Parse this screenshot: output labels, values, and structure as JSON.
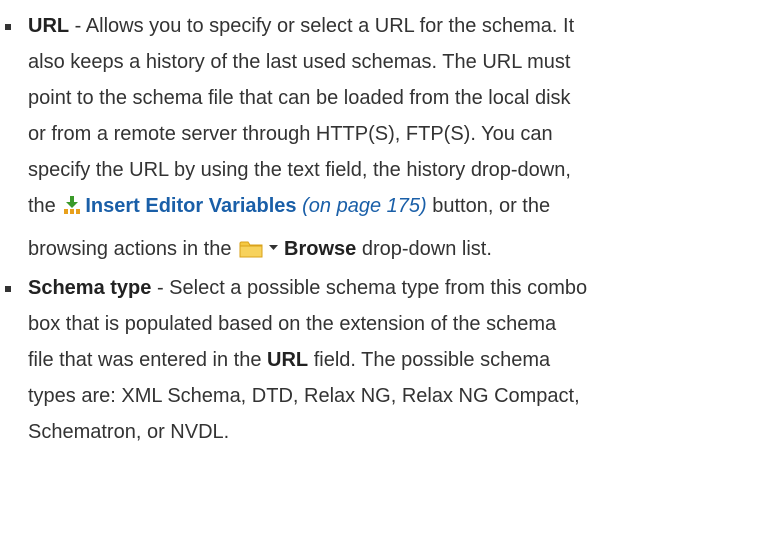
{
  "items": [
    {
      "term": "URL",
      "lines": {
        "l1": " - Allows you to specify or select a URL for the schema. It",
        "l2": "also keeps a history of the last used schemas. The URL must",
        "l3": "point to the schema file that can be loaded from the local disk",
        "l4": "or from a remote server through HTTP(S), FTP(S). You can",
        "l5": "specify the URL by using the text field, the history drop-down,",
        "l6_pre": "the ",
        "l6_link": "Insert Editor Variables",
        "l6_ref": "(on page 175)",
        "l6_post": " button, or the",
        "l7_pre": "browsing actions in the ",
        "l7_bold": "Browse",
        "l7_post": " drop-down list."
      }
    },
    {
      "term": "Schema type",
      "lines": {
        "l1": " - Select a possible schema type from this combo",
        "l2": "box that is populated based on the extension of the schema",
        "l3_pre": "file that was entered in the ",
        "l3_bold": "URL",
        "l3_post": " field. The possible schema",
        "l4": "types are: XML Schema, DTD, Relax NG, Relax NG Compact,",
        "l5": "Schematron, or NVDL."
      }
    }
  ],
  "icons": {
    "insert_editor_variables": "insert-variables-icon",
    "browse_folder": "folder-icon",
    "browse_dropdown": "dropdown-caret-icon"
  },
  "colors": {
    "text": "#333333",
    "link": "#1a5fa8",
    "insert_icon": "#e8a01c",
    "folder_icon": "#f5c842"
  }
}
